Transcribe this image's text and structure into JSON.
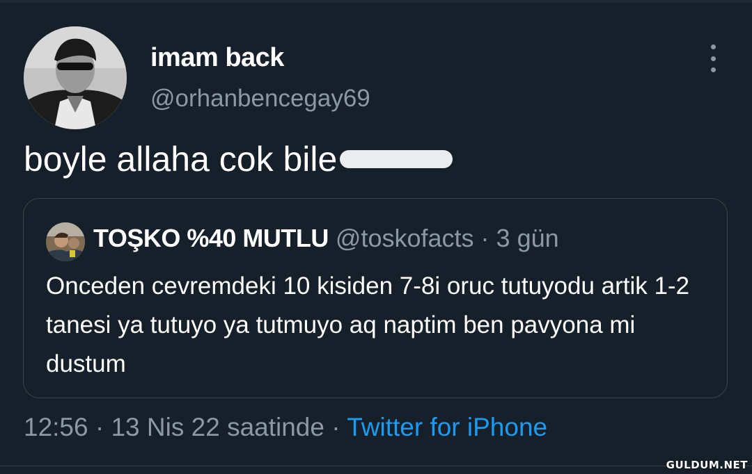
{
  "tweet": {
    "author": {
      "display_name": "imam back",
      "handle": "@orhanbencegay69"
    },
    "text": "boyle allaha cok bile",
    "quoted_tweet": {
      "display_name": "TOŞKO %40 MUTLU",
      "handle": "@toskofacts",
      "separator": "·",
      "time_ago": "3 gün",
      "text": "Onceden cevremdeki 10 kisiden 7-8i oruc tutuyodu artik 1-2 tanesi ya tutuyo ya tutmuyo aq naptim ben pavyona mi dustum"
    },
    "meta": {
      "time": "12:56",
      "separator": "·",
      "date": "13 Nis 22 saatinde",
      "source": "Twitter for iPhone"
    }
  },
  "watermark": "GULDUM.NET",
  "colors": {
    "background": "#15202b",
    "secondary_text": "#8b98a5",
    "link": "#1d9bf0",
    "border": "#38444d"
  },
  "icons": {
    "more": "more-vertical-icon"
  }
}
